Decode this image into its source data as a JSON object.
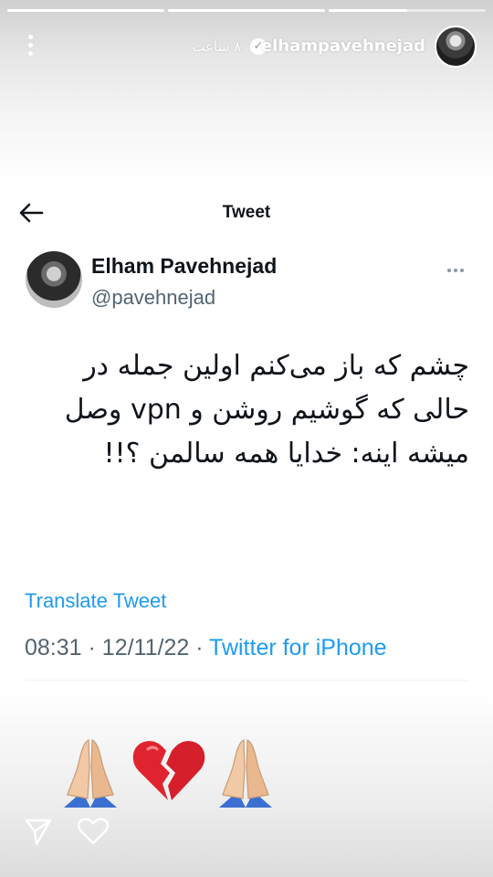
{
  "story": {
    "progress": [
      1.0,
      1.0,
      0.5
    ],
    "username": "elhampavehnejad",
    "verified": true,
    "time_ago": "۸ ساعت"
  },
  "tweet": {
    "topbar_title": "Tweet",
    "author_name": "Elham Pavehnejad",
    "author_handle": "@pavehnejad",
    "text": "چشم که باز می‌کنم اولین جمله در حالی که گوشیم روشن و vpn وصل میشه اینه: خدایا همه سالمن ؟!!",
    "translate_label": "Translate Tweet",
    "time": "08:31",
    "date": "12/11/22",
    "source": "Twitter for iPhone"
  },
  "emojis": [
    "folded-hands",
    "broken-heart",
    "folded-hands"
  ],
  "colors": {
    "twitter_blue": "#1d9bf0",
    "text_primary": "#0f1419",
    "text_secondary": "#536471",
    "heart_red": "#e0242f"
  },
  "icons": [
    "more-vertical-icon",
    "verified-icon",
    "back-arrow-icon",
    "more-horizontal-icon",
    "share-icon",
    "heart-icon"
  ]
}
